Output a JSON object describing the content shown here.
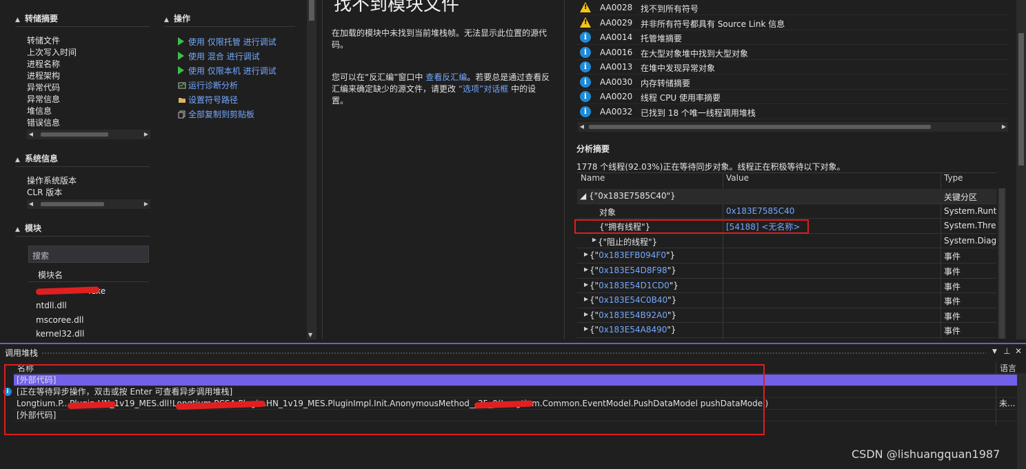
{
  "left_panel": {
    "dump_summary": {
      "title": "转储摘要",
      "fields": [
        "转储文件",
        "上次写入时间",
        "进程名称",
        "进程架构",
        "异常代码",
        "异常信息",
        "堆信息",
        "错误信息"
      ]
    },
    "actions": {
      "title": "操作",
      "items": [
        {
          "icon": "play-icon",
          "label": "使用 仅限托管 进行调试"
        },
        {
          "icon": "play-icon",
          "label": "使用 混合 进行调试"
        },
        {
          "icon": "play-icon",
          "label": "使用 仅限本机 进行调试"
        },
        {
          "icon": "diagnostics-icon",
          "label": "运行诊断分析"
        },
        {
          "icon": "folder-icon",
          "label": "设置符号路径"
        },
        {
          "icon": "copy-icon",
          "label": "全部复制到剪贴板"
        }
      ]
    },
    "system_info": {
      "title": "系统信息",
      "fields": [
        "操作系统版本",
        "CLR 版本"
      ]
    },
    "modules": {
      "title": "模块",
      "search_placeholder": "搜索",
      "column_header": "模块名",
      "items": [
        ".exe",
        "ntdll.dll",
        "mscoree.dll",
        "kernel32.dll"
      ]
    }
  },
  "middle_panel": {
    "title": "找不到模块文件",
    "para1": "在加载的模块中未找到当前堆栈帧。无法显示此位置的源代码。",
    "para2_a": "您可以在“反汇编”窗口中 ",
    "para2_link1": "查看反汇编",
    "para2_b": "。若要总是通过查看反汇编来确定缺少的源文件，请更改 ",
    "para2_link2": "“选项”对话框",
    "para2_c": " 中的设置。"
  },
  "right_panel": {
    "rules": [
      {
        "icon": "warning-icon",
        "code": "AA0028",
        "message": "找不到所有符号"
      },
      {
        "icon": "warning-icon",
        "code": "AA0029",
        "message": "并非所有符号都具有 Source Link 信息"
      },
      {
        "icon": "info-icon",
        "code": "AA0014",
        "message": "托管堆摘要"
      },
      {
        "icon": "info-icon",
        "code": "AA0016",
        "message": "在大型对象堆中找到大型对象"
      },
      {
        "icon": "info-icon",
        "code": "AA0013",
        "message": "在堆中发现异常对象"
      },
      {
        "icon": "info-icon",
        "code": "AA0030",
        "message": "内存转储摘要"
      },
      {
        "icon": "info-icon",
        "code": "AA0020",
        "message": "线程 CPU 使用率摘要"
      },
      {
        "icon": "info-icon",
        "code": "AA0032",
        "message": "已找到 18 个唯一线程调用堆栈"
      }
    ],
    "analysis_title": "分析摘要",
    "analysis_text": "1778 个线程(92.03%)正在等待同步对象。线程正在积极等待以下对象。",
    "grid": {
      "headers": [
        "Name",
        "Value",
        "Type"
      ],
      "rows": [
        {
          "name": "◢ {\"0x183E7585C40\"}",
          "value": "",
          "type": "关键分区",
          "value_link": false
        },
        {
          "name": "对象",
          "value": "0x183E7585C40",
          "type": "System.Runtime",
          "value_link": true
        },
        {
          "name": "{\"拥有线程\"}",
          "value": "[54188] <无名称>",
          "type": "System.Thread",
          "value_link": true
        },
        {
          "name": "{\"阻止的线程\"}",
          "value": "",
          "type": "System.Diagnos",
          "value_link": false
        },
        {
          "name": "{\"0x183EFB094F0\"}",
          "value": "",
          "type": "事件",
          "value_link": false
        },
        {
          "name": "{\"0x183E54D8F98\"}",
          "value": "",
          "type": "事件",
          "value_link": false
        },
        {
          "name": "{\"0x183E54D1CD0\"}",
          "value": "",
          "type": "事件",
          "value_link": false
        },
        {
          "name": "{\"0x183E54C0B40\"}",
          "value": "",
          "type": "事件",
          "value_link": false
        },
        {
          "name": "{\"0x183E54B92A0\"}",
          "value": "",
          "type": "事件",
          "value_link": false
        },
        {
          "name": "{\"0x183E54A8490\"}",
          "value": "",
          "type": "事件",
          "value_link": false
        }
      ]
    }
  },
  "call_stack": {
    "title": "调用堆栈",
    "col_name": "名称",
    "col_lang": "语言",
    "rows": [
      {
        "text": "[外部代码]",
        "lang": ""
      },
      {
        "text": "[正在等待异步操作，双击或按 Enter 可查看异步调用堆栈]",
        "lang": ""
      },
      {
        "text": "Longtium.P...Plugin.HN_1v19_MES.dll!Longtium.PCSA.Plugin.HN_1v19_MES.PluginImpl.Init.AnonymousMethod__35_0(Longtium.Common.EventModel.PushDataModel pushDataModel)",
        "lang": "未..."
      },
      {
        "text": "[外部代码]",
        "lang": ""
      }
    ]
  },
  "watermark": "CSDN @lishuangquan1987",
  "colors": {
    "accent": "#6c5fc7",
    "link": "#75a9ff",
    "highlight_row": "#7160e8",
    "annotation_red": "#e01e1e"
  }
}
